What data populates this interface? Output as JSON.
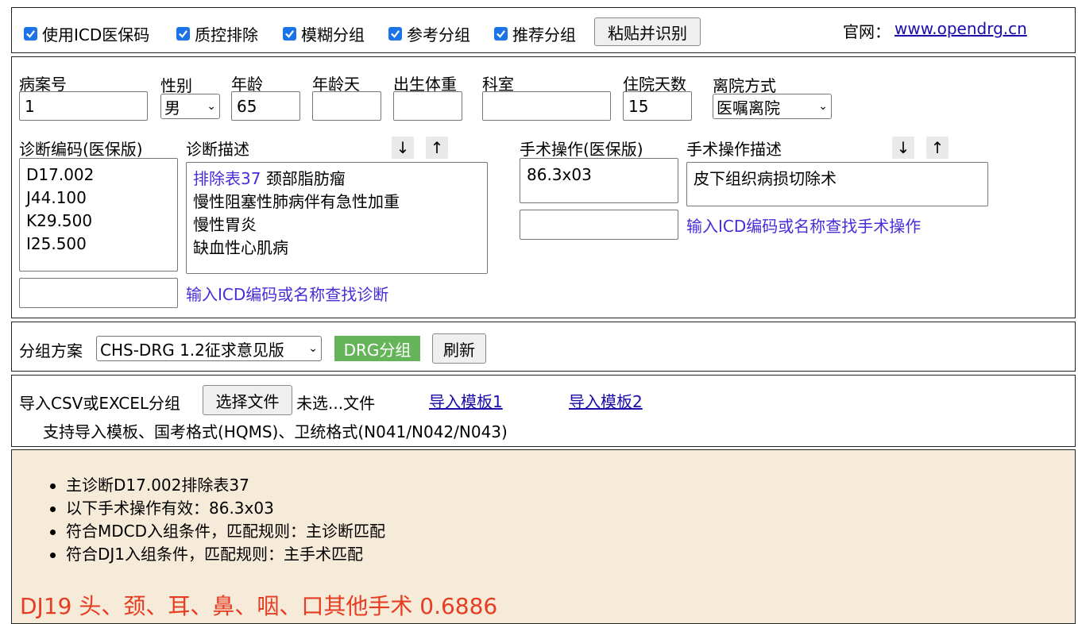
{
  "top_cut_text": "",
  "options": {
    "checkboxes": [
      {
        "label": "使用ICD医保码",
        "checked": true
      },
      {
        "label": "质控排除",
        "checked": true
      },
      {
        "label": "模糊分组",
        "checked": true
      },
      {
        "label": "参考分组",
        "checked": true
      },
      {
        "label": "推荐分组",
        "checked": true
      }
    ],
    "paste_button": "粘贴并识别",
    "site_label": "官网：",
    "site_link": "www.opendrg.cn"
  },
  "patient": {
    "case_no_label": "病案号",
    "case_no_value": "1",
    "sex_label": "性别",
    "sex_value": "男",
    "age_label": "年龄",
    "age_value": "65",
    "age_days_label": "年龄天",
    "age_days_value": "",
    "birth_weight_label": "出生体重",
    "birth_weight_value": "",
    "dept_label": "科室",
    "dept_value": "",
    "los_label": "住院天数",
    "los_value": "15",
    "discharge_label": "离院方式",
    "discharge_value": "医嘱离院"
  },
  "diagnosis": {
    "code_label": "诊断编码(医保版)",
    "desc_label": "诊断描述",
    "codes": [
      "D17.002",
      "J44.100",
      "K29.500",
      "I25.500"
    ],
    "excluded_tag": "排除表37",
    "descs": [
      "颈部脂肪瘤",
      "慢性阻塞性肺病伴有急性加重",
      "慢性胃炎",
      "缺血性心肌病"
    ],
    "search_hint": "输入ICD编码或名称查找诊断",
    "arrow_down": "↓",
    "arrow_up": "↑"
  },
  "surgery": {
    "code_label": "手术操作(医保版)",
    "desc_label": "手术操作描述",
    "codes": [
      "86.3x03"
    ],
    "descs": [
      "皮下组织病损切除术"
    ],
    "search_hint": "输入ICD编码或名称查找手术操作",
    "arrow_down": "↓",
    "arrow_up": "↑"
  },
  "grouping": {
    "scheme_label": "分组方案",
    "scheme_value": "CHS-DRG 1.2征求意见版",
    "drg_button": "DRG分组",
    "refresh_button": "刷新"
  },
  "import": {
    "label": "导入CSV或EXCEL分组",
    "choose_file": "选择文件",
    "no_file": "未选...文件",
    "template1": "导入模板1",
    "template2": "导入模板2",
    "support_text": "支持导入模板、国考格式(HQMS)、卫统格式(N041/N042/N043)"
  },
  "result": {
    "items": [
      "主诊断D17.002排除表37",
      "以下手术操作有效：86.3x03",
      "符合MDCD入组条件，匹配规则：主诊断匹配",
      "符合DJ1入组条件，匹配规则：主手术匹配"
    ],
    "drg_line": "DJ19  头、颈、耳、鼻、咽、口其他手术 0.6886"
  },
  "colors": {
    "accent": "#1a73e8",
    "drg_green": "#66b45a",
    "result_bg": "#f6ead9",
    "result_red": "#e53c22",
    "hint_purple": "#4b2bd8"
  }
}
